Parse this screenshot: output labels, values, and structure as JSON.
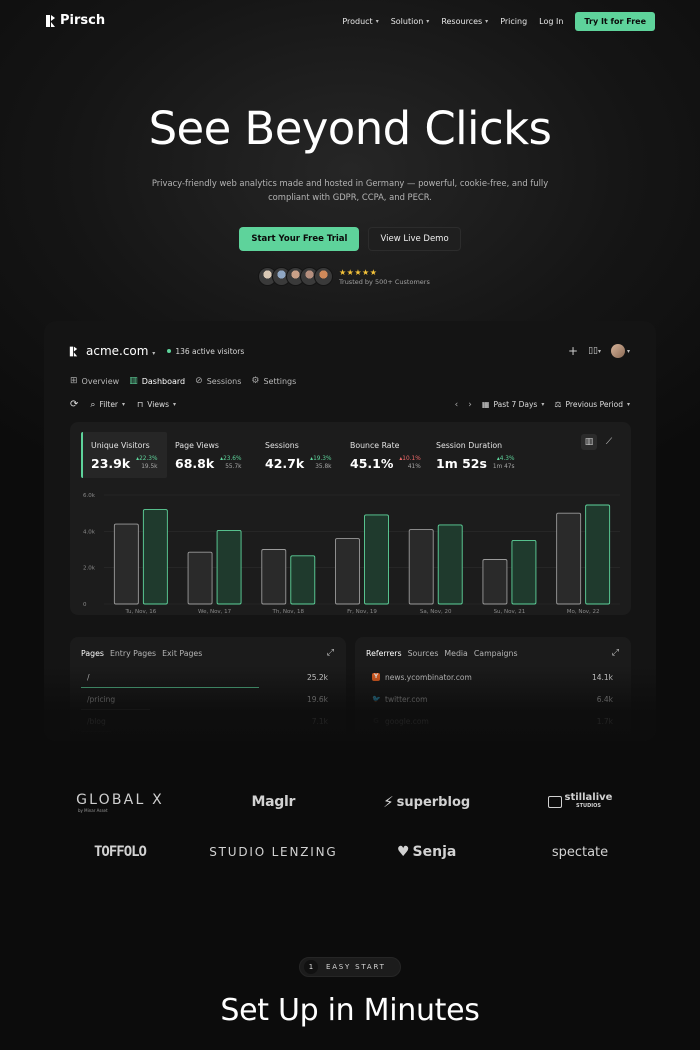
{
  "nav": {
    "brand": "Pirsch",
    "links": [
      {
        "label": "Product",
        "dropdown": true
      },
      {
        "label": "Solution",
        "dropdown": true
      },
      {
        "label": "Resources",
        "dropdown": true
      },
      {
        "label": "Pricing",
        "dropdown": false
      },
      {
        "label": "Log In",
        "dropdown": false
      }
    ],
    "cta": "Try It for Free"
  },
  "hero": {
    "title": "See Beyond Clicks",
    "subtitle": "Privacy-friendly web analytics made and hosted in Germany — powerful, cookie-free, and fully compliant with GDPR, CCPA, and PECR.",
    "primary_cta": "Start Your Free Trial",
    "secondary_cta": "View Live Demo",
    "stars": "★★★★★",
    "trust_text": "Trusted by 500+ Customers",
    "avatar_colors": [
      "#d9c8b4",
      "#8fa7c4",
      "#c9a087",
      "#b58f7e",
      "#d08a5a"
    ]
  },
  "dashboard": {
    "site": "acme.com",
    "active_visitors": "136 active visitors",
    "tabs": [
      {
        "label": "Overview",
        "icon": "grid-icon",
        "glyph": "⊞",
        "active": false
      },
      {
        "label": "Dashboard",
        "icon": "bar-chart-icon",
        "glyph": "▥",
        "active": true
      },
      {
        "label": "Sessions",
        "icon": "compass-icon",
        "glyph": "⊘",
        "active": false
      },
      {
        "label": "Settings",
        "icon": "gear-icon",
        "glyph": "⚙",
        "active": false
      }
    ],
    "tools": {
      "filter": "Filter",
      "views": "Views",
      "period": "Past 7 Days",
      "compare": "Previous Period"
    },
    "metrics": [
      {
        "label": "Unique Visitors",
        "value": "23.9k",
        "change": "▴22.3%",
        "direction": "up",
        "previous": "19.5k",
        "active": true
      },
      {
        "label": "Page Views",
        "value": "68.8k",
        "change": "▴23.6%",
        "direction": "up",
        "previous": "55.7k",
        "active": false
      },
      {
        "label": "Sessions",
        "value": "42.7k",
        "change": "▴19.3%",
        "direction": "up",
        "previous": "35.8k",
        "active": false
      },
      {
        "label": "Bounce Rate",
        "value": "45.1%",
        "change": "▴10.1%",
        "direction": "down",
        "previous": "41%",
        "active": false
      },
      {
        "label": "Session Duration",
        "value": "1m 52s",
        "change": "▴4.3%",
        "direction": "up",
        "previous": "1m 47s",
        "active": false
      }
    ],
    "pages_panel": {
      "tabs": [
        "Pages",
        "Entry Pages",
        "Exit Pages"
      ],
      "rows": [
        {
          "label": "/",
          "value": "25.2k",
          "share": 0.72
        },
        {
          "label": "/pricing",
          "value": "19.6k",
          "share": 0.28
        },
        {
          "label": "/blog",
          "value": "7.1k",
          "share": 0.12
        }
      ]
    },
    "referrers_panel": {
      "tabs": [
        "Referrers",
        "Sources",
        "Media",
        "Campaigns"
      ],
      "rows": [
        {
          "label": "news.ycombinator.com",
          "value": "14.1k",
          "icon": "ycombinator-icon",
          "glyph": "Y",
          "color": "#f26522"
        },
        {
          "label": "twitter.com",
          "value": "6.4k",
          "icon": "twitter-icon",
          "glyph": "🐦",
          "color": "#1d9bf0"
        },
        {
          "label": "google.com",
          "value": "1.7k",
          "icon": "google-icon",
          "glyph": "G",
          "color": "#555555"
        }
      ]
    }
  },
  "chart_data": {
    "type": "bar",
    "categories": [
      "Tu, Nov, 16",
      "We, Nov, 17",
      "Th, Nov, 18",
      "Fr, Nov, 19",
      "Sa, Nov, 20",
      "Su, Nov, 21",
      "Mo, Nov, 22"
    ],
    "series": [
      {
        "values": [
          4.4,
          2.85,
          3.0,
          3.6,
          4.1,
          2.45,
          5.0
        ]
      },
      {
        "values": [
          5.2,
          4.05,
          2.65,
          4.9,
          4.35,
          3.5,
          5.45
        ]
      }
    ],
    "y_ticks": [
      "0",
      "2.0k",
      "4.0k",
      "6.0k"
    ],
    "ylim": [
      0,
      6
    ],
    "colors": {
      "previous": "#9a9a9a",
      "current": "#5ed39b"
    },
    "grid": true
  },
  "logos": [
    [
      "GLOBAL X",
      "Maglr",
      "superblog",
      "stillalive"
    ],
    [
      "TOFFOLO",
      "STUDIO LENZING",
      "Senja",
      "spectate"
    ]
  ],
  "logo_subtexts": {
    "global": "by Minar Asset",
    "stillalive": "STUDIOS"
  },
  "section": {
    "step": "1",
    "label": "EASY START",
    "title": "Set Up in Minutes"
  }
}
